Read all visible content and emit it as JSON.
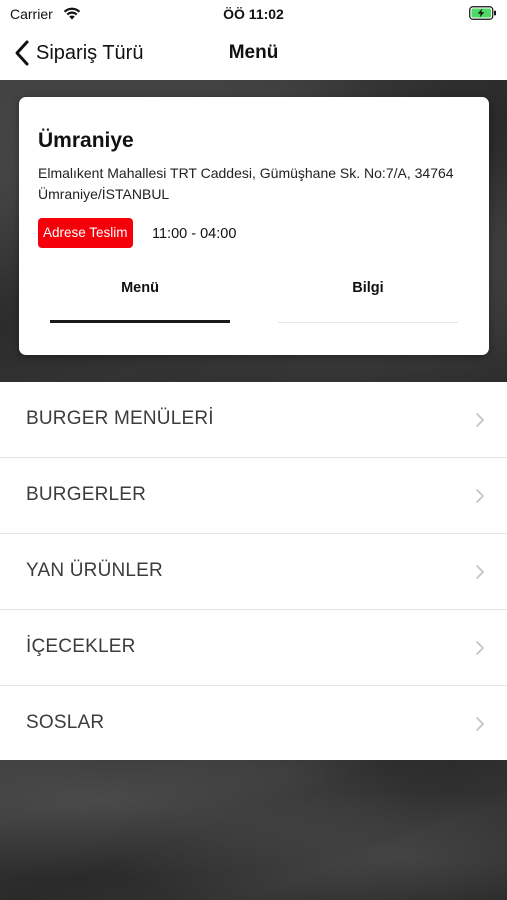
{
  "status_bar": {
    "carrier": "Carrier",
    "time": "ÖÖ 11:02",
    "icons": [
      "wifi-icon",
      "battery-charging-icon"
    ],
    "battery_color": "#4cd964"
  },
  "nav": {
    "back_label": "Sipariş Türü",
    "title": "Menü"
  },
  "store": {
    "name": "Ümraniye",
    "address": "Elmalıkent Mahallesi TRT Caddesi, Gümüşhane Sk. No:7/A, 34764 Ümraniye/İSTANBUL",
    "delivery_badge": "Adrese Teslim",
    "hours": "11:00 - 04:00",
    "tabs": [
      {
        "label": "Menü",
        "selected": true
      },
      {
        "label": "Bilgi",
        "selected": false
      }
    ]
  },
  "categories": [
    {
      "label": "BURGER MENÜLERİ"
    },
    {
      "label": "BURGERLER"
    },
    {
      "label": "YAN ÜRÜNLER"
    },
    {
      "label": "İÇECEKLER"
    },
    {
      "label": "SOSLAR"
    }
  ],
  "colors": {
    "accent_red": "#f5000a",
    "chalkboard": "#2e2e2e",
    "category_text": "#3c3c3c"
  }
}
